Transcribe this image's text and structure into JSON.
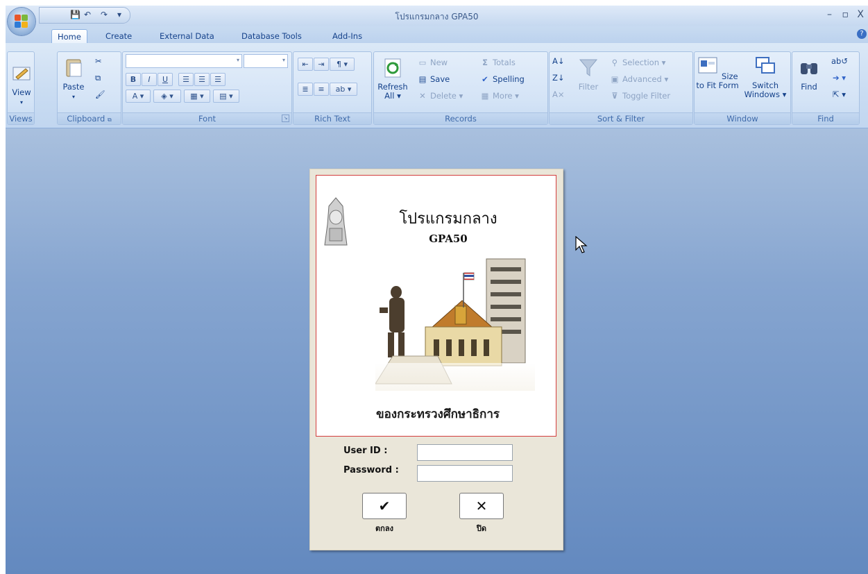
{
  "window": {
    "title": "โปรแกรมกลาง GPA50",
    "minimize": "–",
    "restore": "▫",
    "close": "X"
  },
  "quick_access": {
    "save": "💾",
    "undo": "↶",
    "redo": "↷",
    "more": "▾"
  },
  "tabs": [
    "Home",
    "Create",
    "External Data",
    "Database Tools",
    "Add-Ins"
  ],
  "help": "?",
  "ribbon": {
    "views": {
      "label": "Views",
      "view_button": "View"
    },
    "clipboard": {
      "label": "Clipboard",
      "paste_button": "Paste"
    },
    "font": {
      "label": "Font",
      "bold": "B",
      "italic": "I",
      "underline": "U"
    },
    "rich_text": {
      "label": "Rich Text"
    },
    "records": {
      "label": "Records",
      "refresh": "Refresh",
      "refresh_sub": "All ▾",
      "new": "New",
      "save": "Save",
      "delete": "Delete ▾",
      "totals": "Totals",
      "spelling": "Spelling",
      "more": "More ▾"
    },
    "sort_filter": {
      "label": "Sort & Filter",
      "filter": "Filter",
      "selection": "Selection ▾",
      "advanced": "Advanced ▾",
      "toggle_filter": "Toggle Filter"
    },
    "window": {
      "label": "Window",
      "size_to_fit": "Size to Fit Form",
      "switch_windows": "Switch Windows ▾"
    },
    "find": {
      "label": "Find",
      "find_button": "Find"
    }
  },
  "login": {
    "program_title": "โปรแกรมกลาง",
    "program_code": "GPA50",
    "ministry": "ของกระทรวงศึกษาธิการ",
    "user_id_label": "User ID :",
    "password_label": "Password :",
    "user_id_value": "",
    "password_value": "",
    "ok_label": "ตกลง",
    "close_label": "ปิด",
    "ok_icon": "✔",
    "close_icon": "✕"
  },
  "colors": {
    "workspace_top": "#a9c0de",
    "workspace_bottom": "#6389bf",
    "form_bg": "#eae6d9",
    "picture_border": "#d33d3d"
  }
}
